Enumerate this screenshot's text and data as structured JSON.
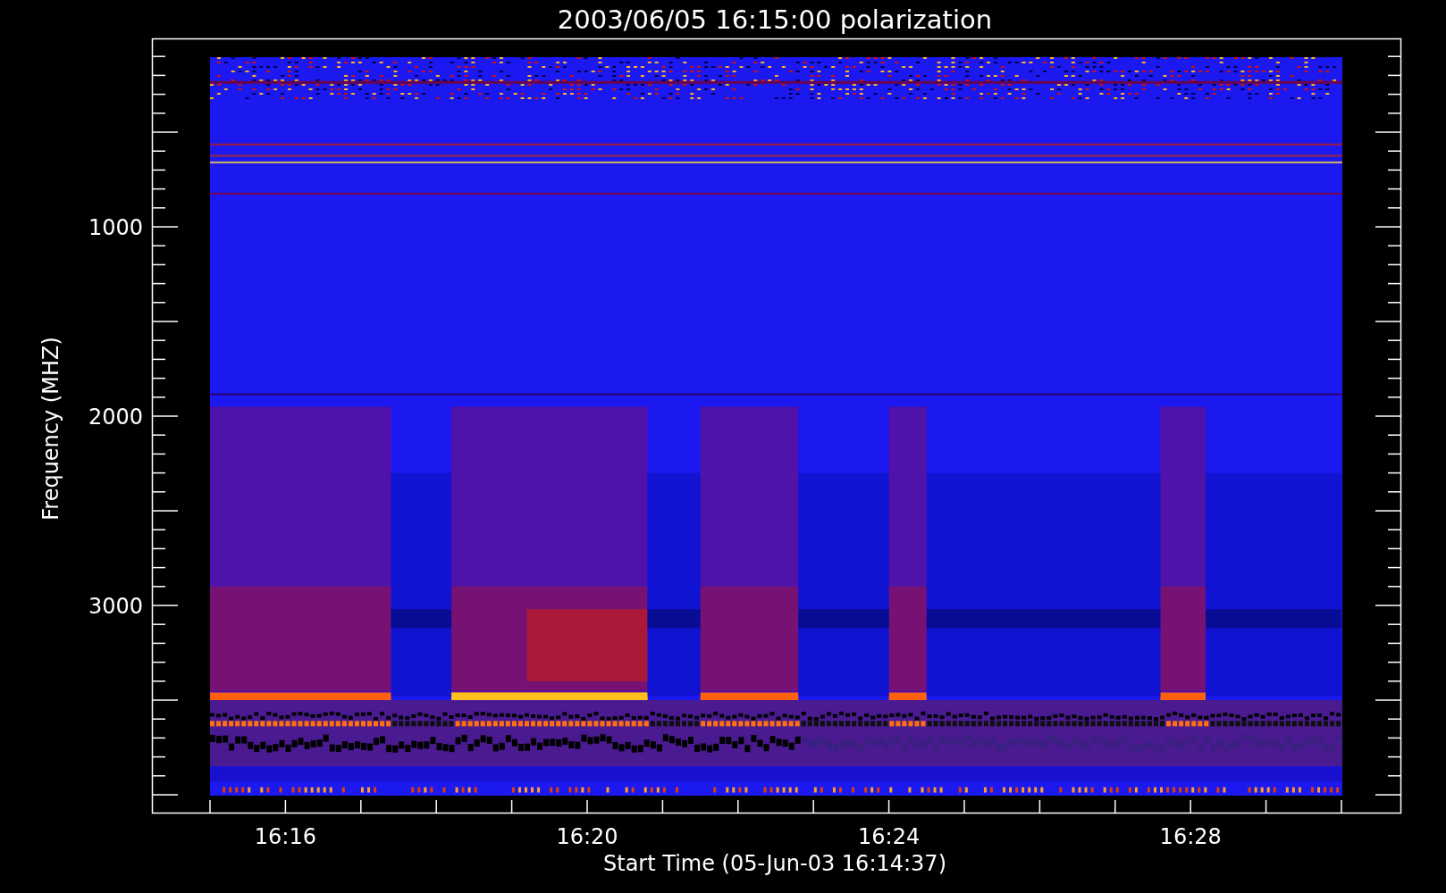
{
  "title": "2003/06/05 16:15:00 polarization",
  "y_axis": {
    "label": "Frequency (MHZ)",
    "ticks": [
      {
        "label": "1000"
      },
      {
        "label": "2000"
      },
      {
        "label": "3000"
      }
    ]
  },
  "x_axis": {
    "label": "Start Time (05-Jun-03 16:14:37)",
    "ticks": [
      {
        "label": "16:16"
      },
      {
        "label": "16:20"
      },
      {
        "label": "16:24"
      },
      {
        "label": "16:28"
      }
    ]
  }
}
